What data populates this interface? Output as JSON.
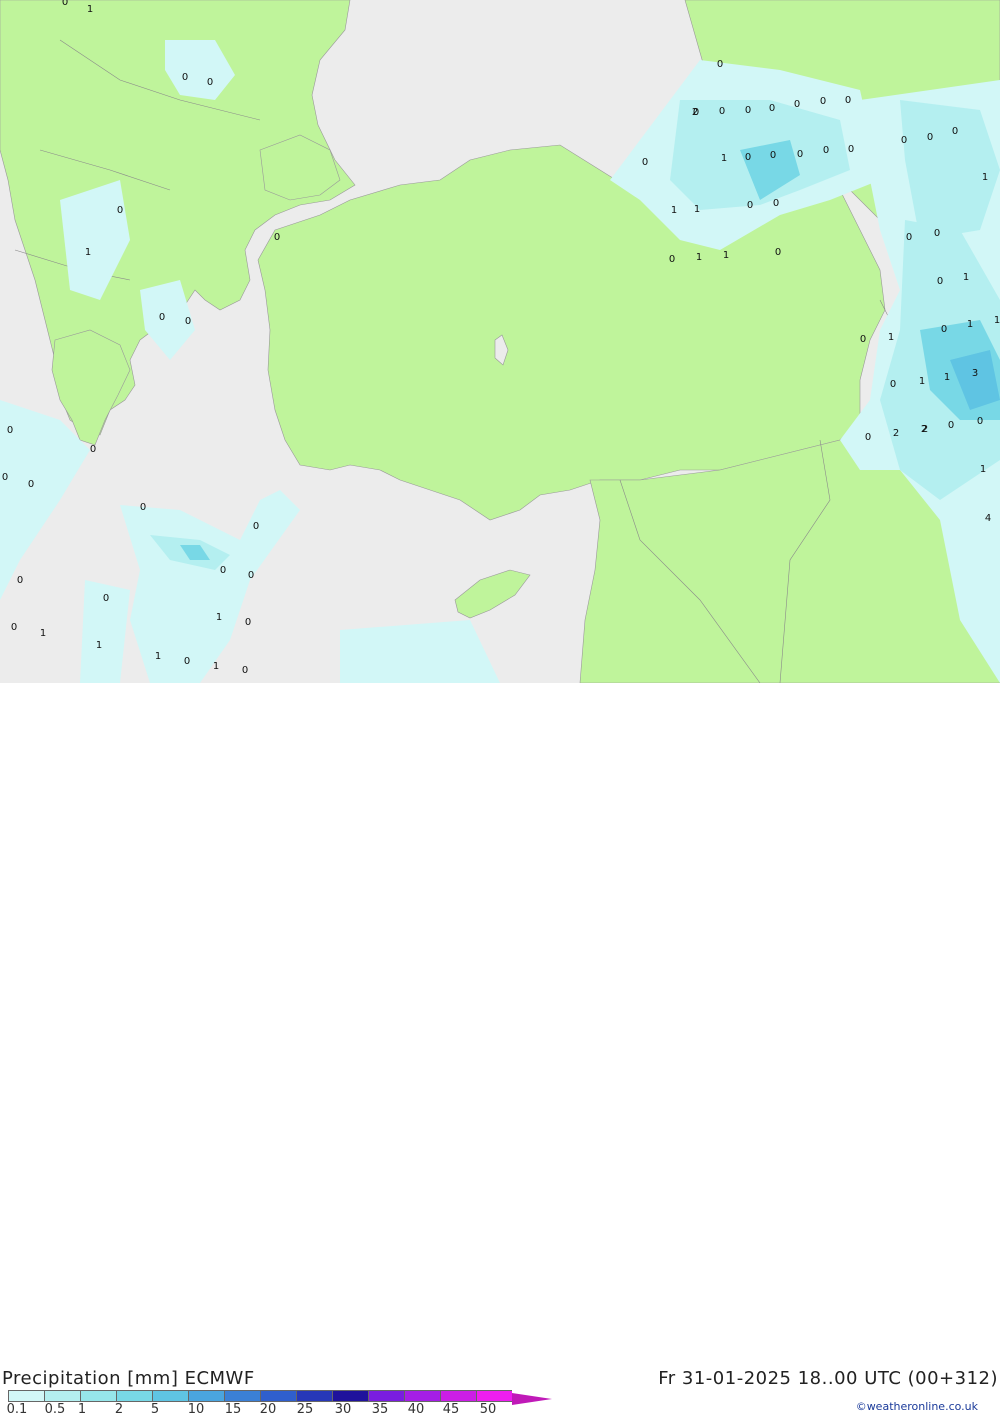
{
  "title_left": "Precipitation [mm] ECMWF",
  "title_right": "Fr 31-01-2025 18..00 UTC (00+312)",
  "credit": "©weatheronline.co.uk",
  "legend": {
    "ticks": [
      "0.1",
      "0.5",
      "1",
      "2",
      "5",
      "10",
      "15",
      "20",
      "25",
      "30",
      "35",
      "40",
      "45",
      "50"
    ],
    "colors": [
      "#d2f7f7",
      "#b4eff0",
      "#96e6ea",
      "#78d8e6",
      "#5fc4e3",
      "#4aa5df",
      "#3b80d6",
      "#2f5fcd",
      "#2738b8",
      "#1f129c",
      "#7a1de0",
      "#a51ee6",
      "#cc1ee6",
      "#ee1ef0",
      "#c01ab8"
    ]
  },
  "map_values": [
    {
      "label": "0"
    },
    {
      "label": "1"
    },
    {
      "label": "0"
    },
    {
      "label": "0"
    },
    {
      "label": "0"
    },
    {
      "label": "1"
    },
    {
      "label": "0"
    },
    {
      "label": "0"
    },
    {
      "label": "0"
    },
    {
      "label": "0"
    },
    {
      "label": "0"
    },
    {
      "label": "0"
    },
    {
      "label": "0"
    },
    {
      "label": "0"
    },
    {
      "label": "0"
    },
    {
      "label": "0"
    },
    {
      "label": "1"
    },
    {
      "label": "0"
    },
    {
      "label": "0"
    },
    {
      "label": "0"
    },
    {
      "label": "0"
    },
    {
      "label": "1"
    },
    {
      "label": "1"
    },
    {
      "label": "0"
    },
    {
      "label": "1"
    },
    {
      "label": "0"
    },
    {
      "label": "0"
    },
    {
      "label": "0"
    },
    {
      "label": "0"
    },
    {
      "label": "0"
    },
    {
      "label": "0"
    },
    {
      "label": "0"
    },
    {
      "label": "2"
    },
    {
      "label": "0"
    },
    {
      "label": "0"
    },
    {
      "label": "1"
    },
    {
      "label": "0"
    },
    {
      "label": "0"
    },
    {
      "label": "0"
    },
    {
      "label": "0"
    },
    {
      "label": "0"
    },
    {
      "label": "1"
    },
    {
      "label": "1"
    },
    {
      "label": "0"
    },
    {
      "label": "0"
    },
    {
      "label": "0"
    },
    {
      "label": "1"
    },
    {
      "label": "1"
    },
    {
      "label": "0"
    },
    {
      "label": "0"
    },
    {
      "label": "0"
    },
    {
      "label": "0"
    },
    {
      "label": "0"
    },
    {
      "label": "0"
    },
    {
      "label": "0"
    },
    {
      "label": "0"
    },
    {
      "label": "1"
    },
    {
      "label": "1"
    },
    {
      "label": "0"
    },
    {
      "label": "1"
    },
    {
      "label": "1"
    },
    {
      "label": "1"
    },
    {
      "label": "0"
    },
    {
      "label": "1"
    },
    {
      "label": "2"
    },
    {
      "label": "0"
    },
    {
      "label": "0"
    },
    {
      "label": "1"
    },
    {
      "label": "1"
    },
    {
      "label": "3"
    },
    {
      "label": "0"
    },
    {
      "label": "2"
    },
    {
      "label": "2"
    },
    {
      "label": "0"
    },
    {
      "label": "1"
    },
    {
      "label": "4"
    },
    {
      "label": "0"
    }
  ]
}
